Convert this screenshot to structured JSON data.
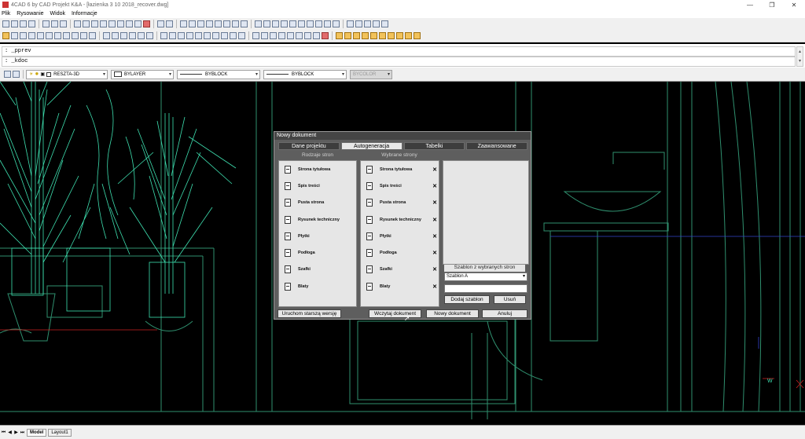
{
  "window": {
    "title": "4CAD 6 by CAD Projekt K&A - [łazienka 3 10 2018_recover.dwg]",
    "controls": [
      "—",
      "❐",
      "✕"
    ]
  },
  "menu": [
    "Plik",
    "Rysowanie",
    "Widok",
    "Informacje"
  ],
  "command": {
    "line1": ": _pprev",
    "line2": ": _kdoc"
  },
  "properties": {
    "layer": "RESZTA-3D",
    "color": "BYLAYER",
    "linetype": "BYBLOCK",
    "lineweight": "BYBLOCK",
    "plotstyle": "BYCOLOR"
  },
  "layout_tabs": {
    "model": "Model",
    "layout1": "Layout1"
  },
  "colors": {
    "drawing_teal": "#3ee0b0",
    "drawing_green": "#2f8f6e",
    "drawing_blue": "#3344cc",
    "drawing_red": "#cc2222"
  },
  "dialog": {
    "title": "Nowy dokument",
    "tabs": [
      "Dane projektu",
      "Autogeneracja",
      "Tabelki",
      "Zaawansowane"
    ],
    "selected_tab": "Autogeneracja",
    "left_header": "Rodzaje stron",
    "right_header": "Wybrane strony",
    "left_items": [
      "Strona tytułowa",
      "Spis treści",
      "Pusta strona",
      "Rysunek techniczny",
      "Płytki",
      "Podłoga",
      "Szafki",
      "Blaty"
    ],
    "right_items": [
      "Strona tytułowa",
      "Spis treści",
      "Pusta strona",
      "Rysunek techniczny",
      "Płytki",
      "Podłoga",
      "Szafki",
      "Blaty"
    ],
    "remove_glyph": "✕",
    "template_label": "Szablon z wybranych stron",
    "template_value": "Szablon A",
    "add_template": "Dodaj szablon",
    "remove_template": "Usuń",
    "run_older": "Uruchom starszą wersję",
    "load_doc": "Wczytaj dokument",
    "new_doc": "Nowy dokument",
    "cancel": "Anuluj"
  }
}
